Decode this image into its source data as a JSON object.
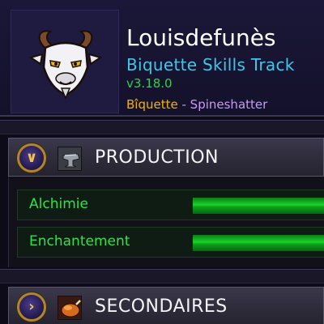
{
  "header": {
    "character_name": "Louisdefunès",
    "addon_name": "Biquette Skills Track",
    "version": "v3.18.0",
    "character": "Bîquette",
    "separator": " - ",
    "realm": "Spineshatter",
    "portrait_icon": "goat-mascot-icon"
  },
  "categories": [
    {
      "label": "PRODUCTION",
      "toggle_symbol": "∨",
      "state": "expanded",
      "icon": "anvil-icon",
      "skills": [
        {
          "name": "Alchimie",
          "progress": 1.0
        },
        {
          "name": "Enchantement",
          "progress": 1.0
        }
      ]
    },
    {
      "label": "SECONDAIRES",
      "toggle_symbol": "›",
      "state": "collapsed",
      "icon": "cooking-icon"
    }
  ],
  "colors": {
    "name": "#ffffff",
    "addon": "#3fc7eb",
    "version": "#2fd04f",
    "character": "#f0b400",
    "realm": "#c79bf5",
    "skill_text": "#31e04a",
    "bar": "#1bd42b"
  }
}
